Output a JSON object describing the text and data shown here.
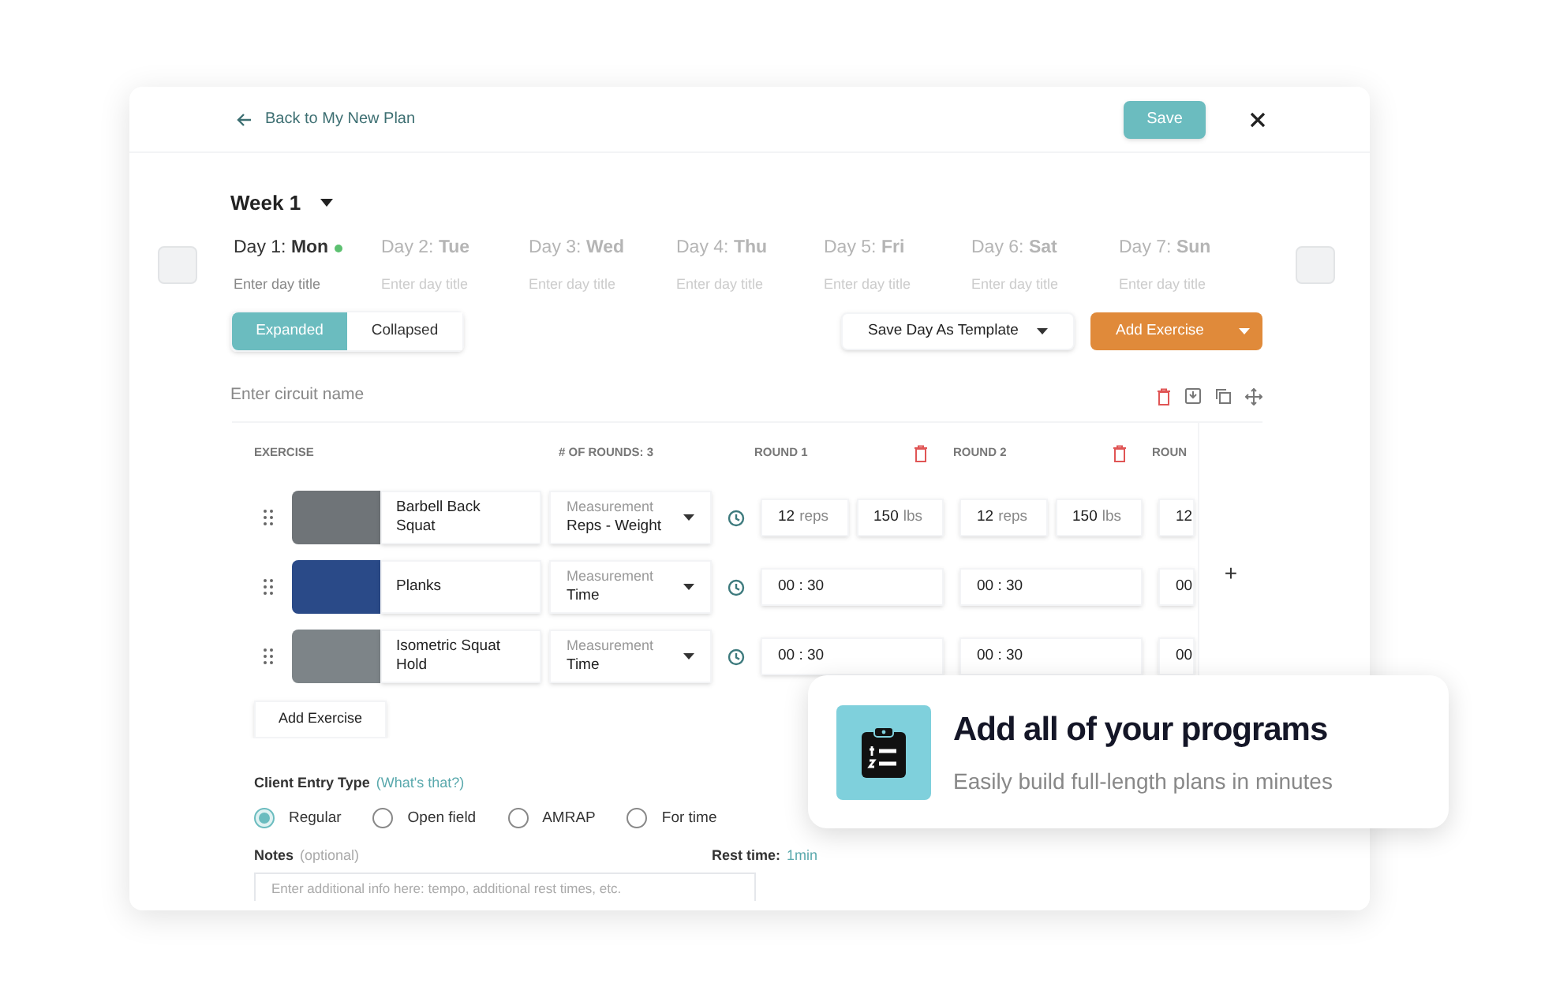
{
  "header": {
    "back_link": "Back to My New Plan",
    "save_button": "Save"
  },
  "week": {
    "label": "Week 1"
  },
  "days": [
    {
      "prefix": "Day 1:",
      "day": "Mon",
      "placeholder": "Enter day title",
      "selected": true,
      "marked": true
    },
    {
      "prefix": "Day 2:",
      "day": "Tue",
      "placeholder": "Enter day title",
      "selected": false,
      "marked": false
    },
    {
      "prefix": "Day 3:",
      "day": "Wed",
      "placeholder": "Enter day title",
      "selected": false,
      "marked": false
    },
    {
      "prefix": "Day 4:",
      "day": "Thu",
      "placeholder": "Enter day title",
      "selected": false,
      "marked": false
    },
    {
      "prefix": "Day 5:",
      "day": "Fri",
      "placeholder": "Enter day title",
      "selected": false,
      "marked": false
    },
    {
      "prefix": "Day 6:",
      "day": "Sat",
      "placeholder": "Enter day title",
      "selected": false,
      "marked": false
    },
    {
      "prefix": "Day 7:",
      "day": "Sun",
      "placeholder": "Enter day title",
      "selected": false,
      "marked": false
    }
  ],
  "view_toggle": [
    {
      "label": "Expanded",
      "selected": true
    },
    {
      "label": "Collapsed",
      "selected": false
    }
  ],
  "template_button": "Save Day As Template",
  "add_exercise_button": "Add Exercise",
  "circuit": {
    "placeholder": "Enter circuit name"
  },
  "table": {
    "exercise_column": "EXERCISE",
    "rounds_count": "# OF ROUNDS: 3",
    "round_columns": [
      "ROUND 1",
      "ROUND 2",
      "ROUN"
    ],
    "rows": [
      {
        "name": "Barbell Back Squat",
        "measurement_label": "Measurement",
        "measurement": "Reps - Weight",
        "rounds": [
          [
            {
              "value": "12",
              "unit": "reps"
            },
            {
              "value": "150",
              "unit": "lbs"
            }
          ],
          [
            {
              "value": "12",
              "unit": "reps"
            },
            {
              "value": "150",
              "unit": "lbs"
            }
          ],
          [
            {
              "value": "12"
            }
          ]
        ]
      },
      {
        "name": "Planks",
        "measurement_label": "Measurement",
        "measurement": "Time",
        "rounds": [
          [
            {
              "value": "00 : 30"
            }
          ],
          [
            {
              "value": "00 : 30"
            }
          ],
          [
            {
              "value": "00"
            }
          ]
        ]
      },
      {
        "name": "Isometric Squat Hold",
        "measurement_label": "Measurement",
        "measurement": "Time",
        "rounds": [
          [
            {
              "value": "00 : 30"
            }
          ],
          [
            {
              "value": "00 : 30"
            }
          ],
          [
            {
              "value": "00"
            }
          ]
        ]
      }
    ],
    "add_round": "+"
  },
  "add_exercise_secondary": "Add Exercise",
  "client_entry": {
    "label": "Client Entry Type",
    "link": "(What's that?)",
    "options": [
      {
        "label": "Regular",
        "selected": true
      },
      {
        "label": "Open field",
        "selected": false
      },
      {
        "label": "AMRAP",
        "selected": false
      },
      {
        "label": "For time",
        "selected": false
      }
    ]
  },
  "notes": {
    "label": "Notes",
    "hint": "(optional)",
    "rest_label": "Rest time:",
    "rest_value": "1min",
    "placeholder": "Enter additional info here: tempo, additional rest times, etc."
  },
  "callout": {
    "title": "Add all of your programs",
    "subtitle": "Easily build full-length plans in minutes"
  }
}
